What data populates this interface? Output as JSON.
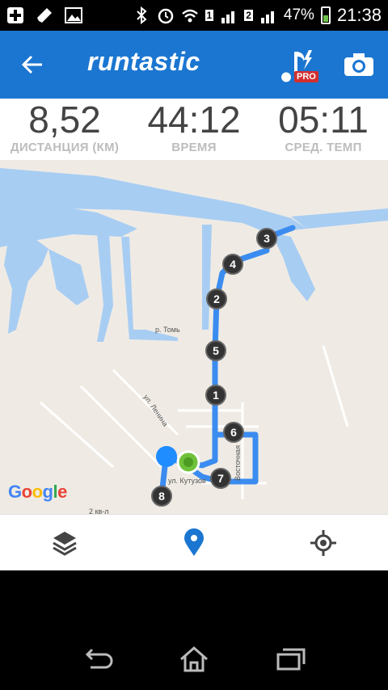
{
  "status_bar": {
    "sim1": "1",
    "sim2": "2",
    "battery_percent": "47%",
    "time": "21:38",
    "icons": [
      "add-icon",
      "pen-icon",
      "image-icon",
      "bluetooth-icon",
      "alarm-icon",
      "wifi-icon",
      "signal-icon",
      "battery-icon"
    ]
  },
  "app_bar": {
    "logo": "runtastic",
    "pro_badge": "PRO",
    "colors": {
      "primary": "#1b76d1",
      "pro": "#d32f2f"
    }
  },
  "stats": [
    {
      "value": "8,52",
      "label": "ДИСТАНЦИЯ (КМ)"
    },
    {
      "value": "44:12",
      "label": "ВРЕМЯ"
    },
    {
      "value": "05:11",
      "label": "СРЕД. ТЕМП"
    }
  ],
  "map": {
    "google_logo": "Google",
    "streets": {
      "river": "р. Томь",
      "lenina": "ул. Ленина",
      "kutuzova": "ул. Кутузов",
      "vostochnaya": "Восточная",
      "bottom": "2 кв-л"
    },
    "km_markers": [
      "1",
      "2",
      "3",
      "4",
      "5",
      "6",
      "7",
      "8"
    ],
    "colors": {
      "water": "#a8cdf3",
      "land": "#efebe4",
      "route": "#3b8cf0",
      "start": "#6ec13a",
      "position": "#1f8cff"
    }
  },
  "bottom_nav": {
    "items": [
      "layers-icon",
      "map-pin-icon",
      "locate-icon"
    ],
    "active": "map-pin-icon"
  },
  "system_nav": {
    "items": [
      "back-icon",
      "home-icon",
      "recents-icon"
    ]
  }
}
